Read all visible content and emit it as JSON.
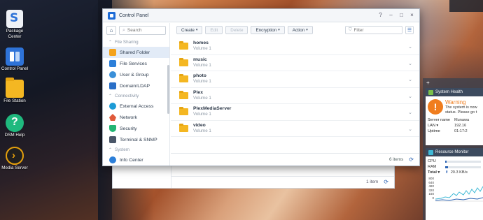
{
  "desktop": {
    "icons": [
      {
        "label_lines": [
          "Package",
          "Center"
        ],
        "icon": "package-center-icon",
        "color": "#e9ecf2"
      },
      {
        "label_lines": [
          "Control Panel"
        ],
        "icon": "control-panel-icon",
        "color": "#2e73d8"
      },
      {
        "label_lines": [
          "File Station"
        ],
        "icon": "file-station-icon",
        "color": "#f4b722"
      },
      {
        "label_lines": [
          "DSM Help"
        ],
        "icon": "dsm-help-icon",
        "color": "#1fb97e"
      },
      {
        "label_lines": [
          "Media Server"
        ],
        "icon": "plex-icon",
        "color": "#e5a00d"
      }
    ]
  },
  "window": {
    "title": "Control Panel",
    "controls": {
      "help": "?",
      "minimize": "–",
      "maximize": "□",
      "close": "×"
    },
    "sidebar": {
      "search_placeholder": "Search",
      "sections": [
        {
          "label": "File Sharing",
          "items": [
            {
              "label": "Shared Folder",
              "icon": "shared-folder-icon",
              "active": true,
              "color": "#f4a21a"
            },
            {
              "label": "File Services",
              "icon": "file-services-icon",
              "color": "#2c7fd9"
            },
            {
              "label": "User & Group",
              "icon": "user-group-icon",
              "color": "#3a8fd8"
            },
            {
              "label": "Domain/LDAP",
              "icon": "domain-ldap-icon",
              "color": "#2a6fc7"
            }
          ]
        },
        {
          "label": "Connectivity",
          "items": [
            {
              "label": "External Access",
              "icon": "external-access-icon",
              "color": "#1d9bd6"
            },
            {
              "label": "Network",
              "icon": "network-icon",
              "color": "#e05a3a"
            },
            {
              "label": "Security",
              "icon": "security-icon",
              "color": "#22b573"
            },
            {
              "label": "Terminal & SNMP",
              "icon": "terminal-icon",
              "color": "#4a5668"
            }
          ]
        },
        {
          "label": "System",
          "items": [
            {
              "label": "Info Center",
              "icon": "info-center-icon",
              "color": "#2c7fd9"
            }
          ]
        }
      ]
    },
    "toolbar": {
      "create": "Create",
      "edit": "Edit",
      "delete": "Delete",
      "encryption": "Encryption",
      "action": "Action",
      "filter_placeholder": "Filter"
    },
    "folders": [
      {
        "name": "homes",
        "volume": "Volume 1"
      },
      {
        "name": "music",
        "volume": "Volume 1"
      },
      {
        "name": "photo",
        "volume": "Volume 1"
      },
      {
        "name": "Plex",
        "volume": "Volume 1"
      },
      {
        "name": "PlexMediaServer",
        "volume": "Volume 1"
      },
      {
        "name": "video",
        "volume": "Volume 1"
      }
    ],
    "status": {
      "count": "6 items"
    }
  },
  "back_window": {
    "status": {
      "count": "1 item"
    }
  },
  "widgets": {
    "system_health": {
      "title": "System Health",
      "status": "Warning",
      "desc_lines": [
        "The system is now",
        "status. Please go t"
      ],
      "rows": [
        {
          "k": "Server name",
          "v": "Munawa"
        },
        {
          "k": "LAN ▾",
          "v": "192.16"
        },
        {
          "k": "Uptime",
          "v": "01:17:2"
        }
      ]
    },
    "resource_monitor": {
      "title": "Resource Monitor",
      "cpu_label": "CPU",
      "cpu": 0.03,
      "ram_label": "RAM",
      "ram": 0.08,
      "total_label": "Total ▾",
      "upload": "20.3 KB/s",
      "y_ticks": [
        "800",
        "640",
        "480",
        "320",
        "160",
        "0"
      ],
      "colors": {
        "upload": "#2c64b4",
        "download": "#3fb9d6"
      }
    }
  }
}
